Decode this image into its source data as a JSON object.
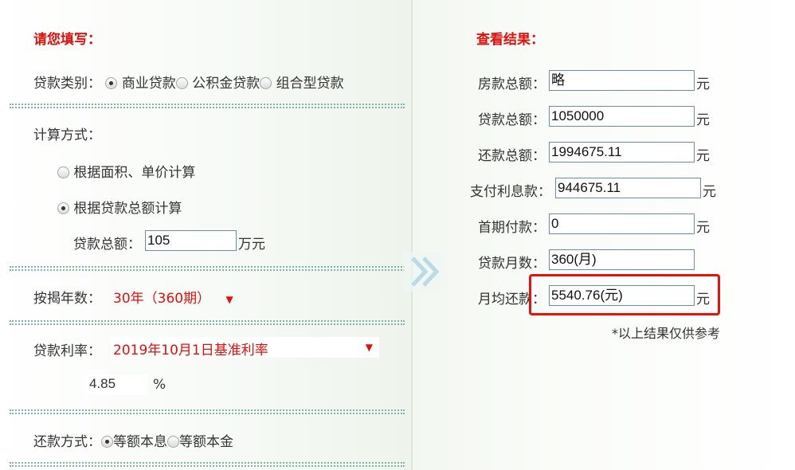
{
  "left": {
    "title": "请您填写：",
    "loan_type": {
      "label": "贷款类别：",
      "options": [
        "商业贷款",
        "公积金贷款",
        "组合型贷款"
      ],
      "selected_index": 0
    },
    "calc_method": {
      "label": "计算方式：",
      "options": [
        "根据面积、单价计算",
        "根据贷款总额计算"
      ],
      "selected_index": 1
    },
    "loan_total": {
      "label": "贷款总额：",
      "value": "105",
      "unit": "万元"
    },
    "years": {
      "label": "按揭年数：",
      "value": "30年（360期）"
    },
    "rate": {
      "label": "贷款利率：",
      "value": "2019年10月1日基准利率",
      "rate_value": "4.85",
      "unit": "%"
    },
    "repay_method": {
      "label": "还款方式：",
      "options": [
        "等额本息",
        "等额本金"
      ],
      "selected_index": 0
    }
  },
  "right": {
    "title": "查看结果：",
    "rows": [
      {
        "label": "房款总额：",
        "value": "略",
        "unit": "元"
      },
      {
        "label": "贷款总额：",
        "value": "1050000",
        "unit": "元"
      },
      {
        "label": "还款总额：",
        "value": "1994675.11",
        "unit": "元"
      },
      {
        "label": "支付利息款：",
        "value": "944675.11",
        "unit": "元"
      },
      {
        "label": "首期付款：",
        "value": "0",
        "unit": "元"
      },
      {
        "label": "贷款月数：",
        "value": "360(月)",
        "unit": ""
      },
      {
        "label": "月均还款：",
        "value": "5540.76(元)",
        "unit": "元"
      }
    ],
    "note": "*以上结果仅供参考"
  },
  "colors": {
    "accent_red": "#e0100c",
    "input_border": "#6a8caa",
    "divider_dots": "#7fb5a8",
    "highlight": "#e8120c"
  },
  "icons": {
    "arrow": "double-chevron-right-icon",
    "dropdown": "triangle-down-icon"
  }
}
